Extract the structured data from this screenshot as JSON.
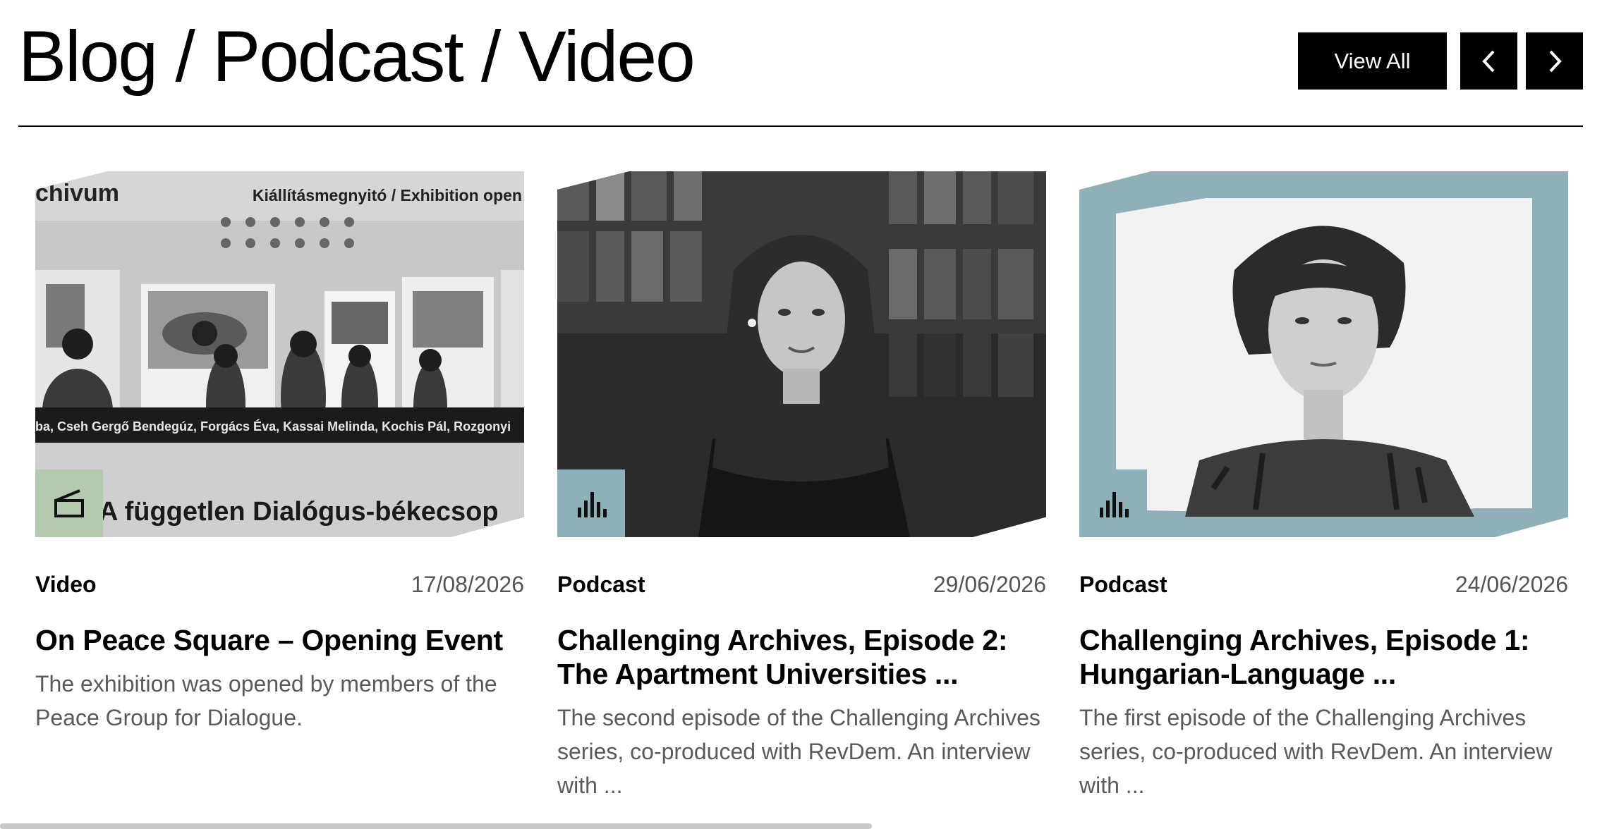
{
  "section": {
    "title": "Blog / Podcast / Video",
    "view_all_label": "View All"
  },
  "colors": {
    "video_badge": "#b5c9b1",
    "podcast_badge": "#8fb0b6",
    "frame_accent": "#8fb0b6",
    "button_bg": "#000000"
  },
  "cards": [
    {
      "type": "Video",
      "date": "17/08/2026",
      "title": "On Peace Square – Opening Event",
      "description": "The exhibition was opened by members of the Peace Group for Dialogue.",
      "badge_icon": "film-icon",
      "image": {
        "banner_left": "chivum",
        "banner_right": "Kiállításmegnyitó / Exhibition open",
        "names_strip": "ba, Cseh Gergő Bendegúz, Forgács Éva, Kassai Melinda, Kochis Pál, Rozgonyi",
        "caption": "A független Dialógus-békecsop"
      }
    },
    {
      "type": "Podcast",
      "date": "29/06/2026",
      "title": "Challenging Archives, Episode 2: The Apartment Universities ...",
      "description": "The second episode of the Challenging Archives series, co-produced with RevDem. An interview with ...",
      "badge_icon": "audio-bars-icon"
    },
    {
      "type": "Podcast",
      "date": "24/06/2026",
      "title": "Challenging Archives, Episode 1: Hungarian-Language ...",
      "description": "The first episode of the Challenging Archives series, co-produced with RevDem. An interview with ...",
      "badge_icon": "audio-bars-icon"
    }
  ]
}
